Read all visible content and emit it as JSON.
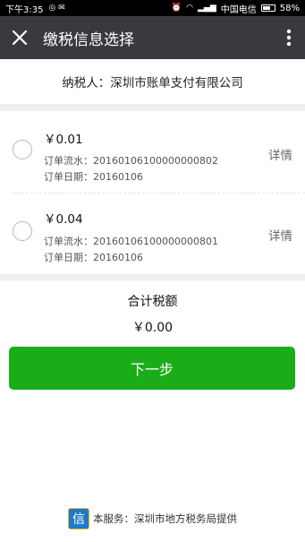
{
  "statusbar": {
    "time": "下午3:35",
    "carrier": "中国电信",
    "battery": "58%"
  },
  "appbar": {
    "title": "缴税信息选择",
    "close_icon": "close-icon",
    "more_icon": "more-vertical-icon"
  },
  "taxpayer": "纳税人：深圳市账单支付有限公司",
  "orders": [
    {
      "amount": "￥0.01",
      "serial": "订单流水：20160106100000000802",
      "date": "订单日期：20160106",
      "detail": "详情"
    },
    {
      "amount": "￥0.04",
      "serial": "订单流水：20160106100000000801",
      "date": "订单日期：20160106",
      "detail": "详情"
    }
  ],
  "total": {
    "label": "合计税额",
    "value": "￥0.00"
  },
  "next_button": "下一步",
  "footer": {
    "logo_text": "信",
    "text": "本服务：深圳市地方税务局提供"
  }
}
